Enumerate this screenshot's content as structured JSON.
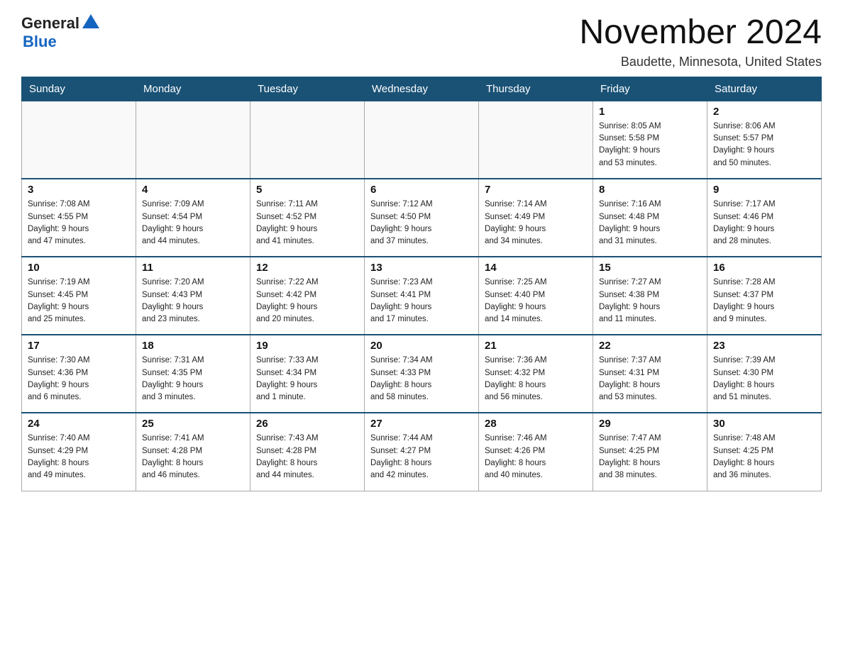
{
  "header": {
    "logo_general": "General",
    "logo_blue": "Blue",
    "month_title": "November 2024",
    "location": "Baudette, Minnesota, United States"
  },
  "weekdays": [
    "Sunday",
    "Monday",
    "Tuesday",
    "Wednesday",
    "Thursday",
    "Friday",
    "Saturday"
  ],
  "weeks": [
    [
      {
        "day": "",
        "info": ""
      },
      {
        "day": "",
        "info": ""
      },
      {
        "day": "",
        "info": ""
      },
      {
        "day": "",
        "info": ""
      },
      {
        "day": "",
        "info": ""
      },
      {
        "day": "1",
        "info": "Sunrise: 8:05 AM\nSunset: 5:58 PM\nDaylight: 9 hours\nand 53 minutes."
      },
      {
        "day": "2",
        "info": "Sunrise: 8:06 AM\nSunset: 5:57 PM\nDaylight: 9 hours\nand 50 minutes."
      }
    ],
    [
      {
        "day": "3",
        "info": "Sunrise: 7:08 AM\nSunset: 4:55 PM\nDaylight: 9 hours\nand 47 minutes."
      },
      {
        "day": "4",
        "info": "Sunrise: 7:09 AM\nSunset: 4:54 PM\nDaylight: 9 hours\nand 44 minutes."
      },
      {
        "day": "5",
        "info": "Sunrise: 7:11 AM\nSunset: 4:52 PM\nDaylight: 9 hours\nand 41 minutes."
      },
      {
        "day": "6",
        "info": "Sunrise: 7:12 AM\nSunset: 4:50 PM\nDaylight: 9 hours\nand 37 minutes."
      },
      {
        "day": "7",
        "info": "Sunrise: 7:14 AM\nSunset: 4:49 PM\nDaylight: 9 hours\nand 34 minutes."
      },
      {
        "day": "8",
        "info": "Sunrise: 7:16 AM\nSunset: 4:48 PM\nDaylight: 9 hours\nand 31 minutes."
      },
      {
        "day": "9",
        "info": "Sunrise: 7:17 AM\nSunset: 4:46 PM\nDaylight: 9 hours\nand 28 minutes."
      }
    ],
    [
      {
        "day": "10",
        "info": "Sunrise: 7:19 AM\nSunset: 4:45 PM\nDaylight: 9 hours\nand 25 minutes."
      },
      {
        "day": "11",
        "info": "Sunrise: 7:20 AM\nSunset: 4:43 PM\nDaylight: 9 hours\nand 23 minutes."
      },
      {
        "day": "12",
        "info": "Sunrise: 7:22 AM\nSunset: 4:42 PM\nDaylight: 9 hours\nand 20 minutes."
      },
      {
        "day": "13",
        "info": "Sunrise: 7:23 AM\nSunset: 4:41 PM\nDaylight: 9 hours\nand 17 minutes."
      },
      {
        "day": "14",
        "info": "Sunrise: 7:25 AM\nSunset: 4:40 PM\nDaylight: 9 hours\nand 14 minutes."
      },
      {
        "day": "15",
        "info": "Sunrise: 7:27 AM\nSunset: 4:38 PM\nDaylight: 9 hours\nand 11 minutes."
      },
      {
        "day": "16",
        "info": "Sunrise: 7:28 AM\nSunset: 4:37 PM\nDaylight: 9 hours\nand 9 minutes."
      }
    ],
    [
      {
        "day": "17",
        "info": "Sunrise: 7:30 AM\nSunset: 4:36 PM\nDaylight: 9 hours\nand 6 minutes."
      },
      {
        "day": "18",
        "info": "Sunrise: 7:31 AM\nSunset: 4:35 PM\nDaylight: 9 hours\nand 3 minutes."
      },
      {
        "day": "19",
        "info": "Sunrise: 7:33 AM\nSunset: 4:34 PM\nDaylight: 9 hours\nand 1 minute."
      },
      {
        "day": "20",
        "info": "Sunrise: 7:34 AM\nSunset: 4:33 PM\nDaylight: 8 hours\nand 58 minutes."
      },
      {
        "day": "21",
        "info": "Sunrise: 7:36 AM\nSunset: 4:32 PM\nDaylight: 8 hours\nand 56 minutes."
      },
      {
        "day": "22",
        "info": "Sunrise: 7:37 AM\nSunset: 4:31 PM\nDaylight: 8 hours\nand 53 minutes."
      },
      {
        "day": "23",
        "info": "Sunrise: 7:39 AM\nSunset: 4:30 PM\nDaylight: 8 hours\nand 51 minutes."
      }
    ],
    [
      {
        "day": "24",
        "info": "Sunrise: 7:40 AM\nSunset: 4:29 PM\nDaylight: 8 hours\nand 49 minutes."
      },
      {
        "day": "25",
        "info": "Sunrise: 7:41 AM\nSunset: 4:28 PM\nDaylight: 8 hours\nand 46 minutes."
      },
      {
        "day": "26",
        "info": "Sunrise: 7:43 AM\nSunset: 4:28 PM\nDaylight: 8 hours\nand 44 minutes."
      },
      {
        "day": "27",
        "info": "Sunrise: 7:44 AM\nSunset: 4:27 PM\nDaylight: 8 hours\nand 42 minutes."
      },
      {
        "day": "28",
        "info": "Sunrise: 7:46 AM\nSunset: 4:26 PM\nDaylight: 8 hours\nand 40 minutes."
      },
      {
        "day": "29",
        "info": "Sunrise: 7:47 AM\nSunset: 4:25 PM\nDaylight: 8 hours\nand 38 minutes."
      },
      {
        "day": "30",
        "info": "Sunrise: 7:48 AM\nSunset: 4:25 PM\nDaylight: 8 hours\nand 36 minutes."
      }
    ]
  ]
}
